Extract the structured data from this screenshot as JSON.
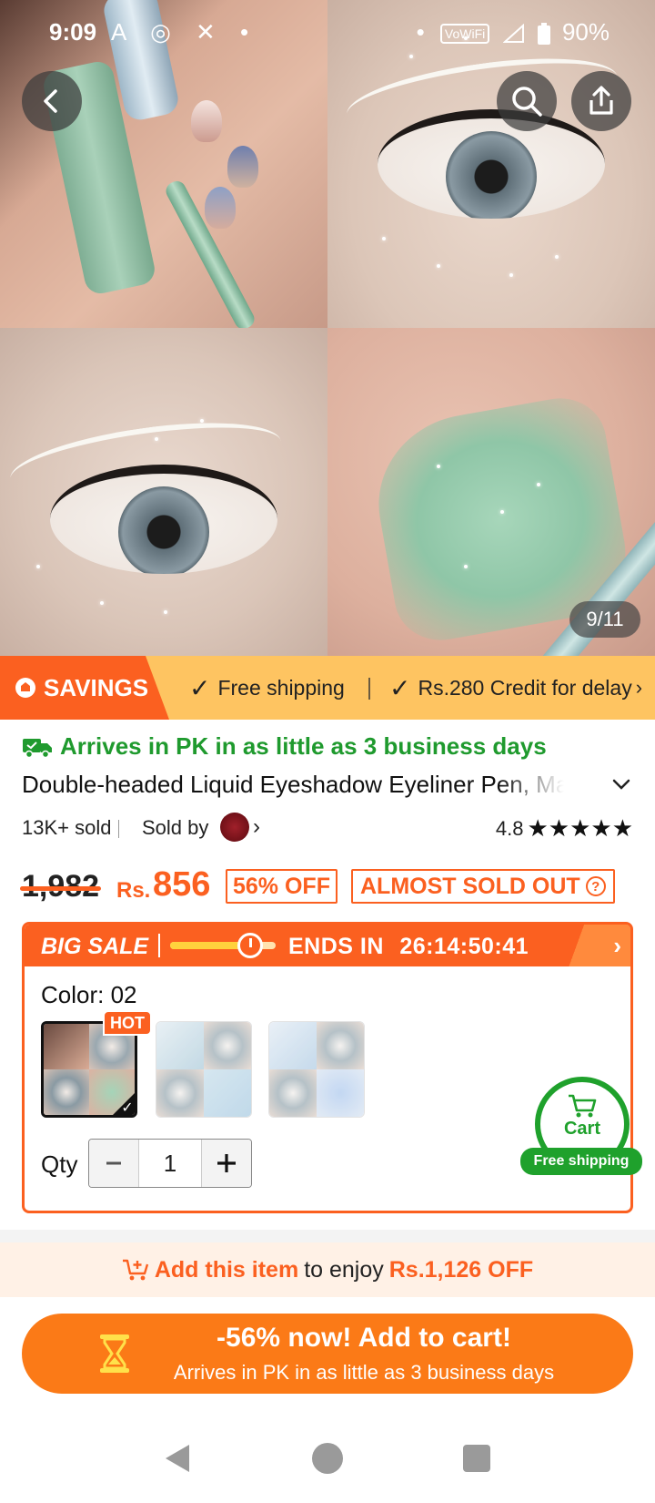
{
  "status_bar": {
    "time": "9:09",
    "left_icons": "A ◎ ✕ •",
    "dot": "•",
    "vowifi": "VoWiFi",
    "battery": "90%"
  },
  "gallery": {
    "counter": "9/11",
    "current_index": 9,
    "total": 11
  },
  "savings_strip": {
    "tag": "SAVINGS",
    "item1": "Free shipping",
    "item2": "Rs.280 Credit for delay"
  },
  "product": {
    "arrives": "Arrives in PK in as little as 3 business days",
    "title": "Double-headed Liquid Eyeshadow Eyeliner Pen, Matte Pearlescent Glitter",
    "sold": "13K+ sold",
    "sold_by": "Sold by",
    "rating": "4.8",
    "stars": "★★★★★",
    "old_price": "1,982",
    "currency": "Rs.",
    "price": "856",
    "off": "56% OFF",
    "scarcity": "ALMOST SOLD OUT"
  },
  "sale": {
    "label": "BIG SALE",
    "ends_in": "ENDS IN",
    "countdown": "26:14:50:41",
    "progress": 0.72,
    "color_label": "Color: 02",
    "hot": "HOT",
    "qty_label": "Qty",
    "qty": "1"
  },
  "cart_float": {
    "label": "Cart",
    "shipping": "Free shipping"
  },
  "promo": {
    "part1": "Add this item",
    "part2": "to enjoy",
    "part3": "Rs.1,126 OFF"
  },
  "cta": {
    "main": "-56% now! Add to cart!",
    "sub": "Arrives in PK in as little as 3 business days"
  },
  "colors": {
    "orange": "#fb6020",
    "green": "#1fa12c",
    "savings_bg": "#fec461"
  }
}
